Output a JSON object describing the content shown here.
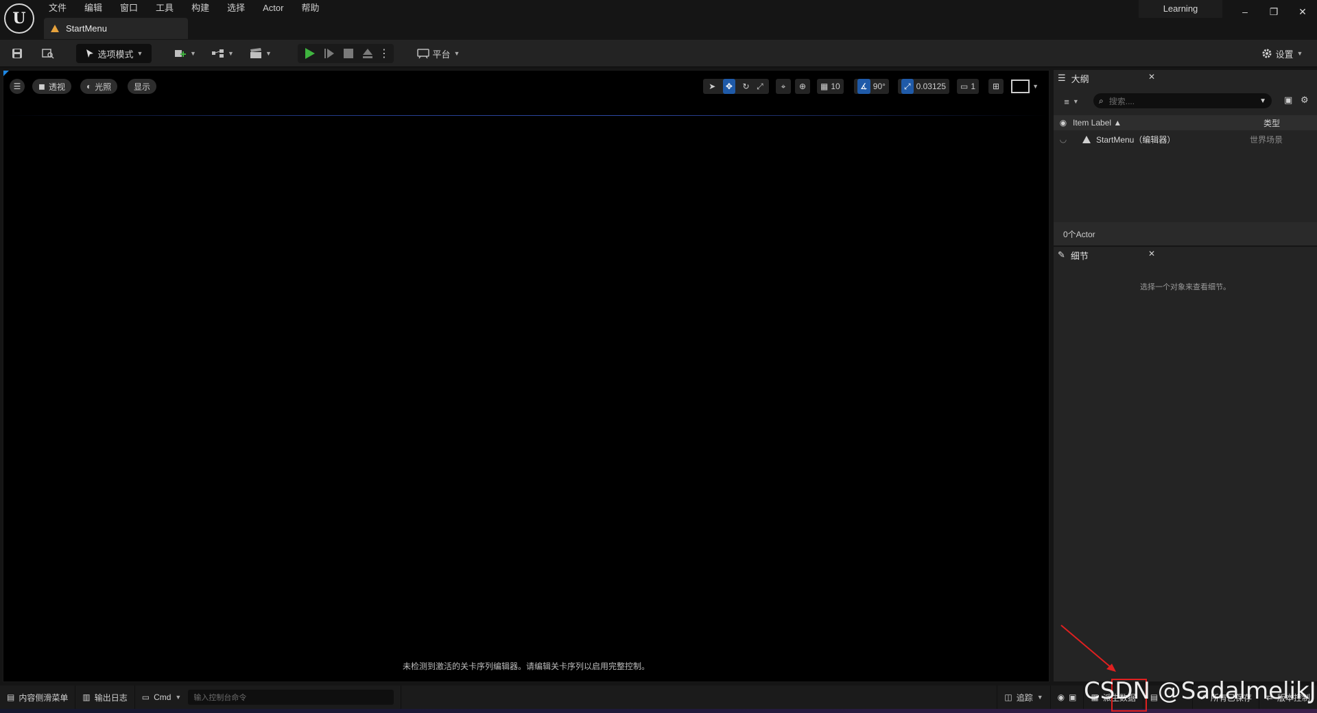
{
  "menu": [
    "文件",
    "编辑",
    "窗口",
    "工具",
    "构建",
    "选择",
    "Actor",
    "帮助"
  ],
  "document_tab": "StartMenu",
  "project_name": "Learning",
  "window_controls": {
    "minimize": "–",
    "restore": "❐",
    "close": "✕"
  },
  "toolbar": {
    "mode_label": "选项模式",
    "platform_label": "平台",
    "settings_label": "设置"
  },
  "viewport": {
    "perspective": "透视",
    "lit": "光照",
    "show": "显示",
    "grid_snap": "10",
    "rotate_snap": "90°",
    "scale_snap": "0.03125",
    "camera_speed": "1",
    "message": "未检测到激活的关卡序列编辑器。请编辑关卡序列以启用完整控制。"
  },
  "outliner": {
    "tab_title": "大纲",
    "search_placeholder": "搜索....",
    "col_label": "Item Label ▲",
    "col_type": "类型",
    "row_label": "StartMenu（编辑器）",
    "row_type": "世界场景",
    "footer": "0个Actor"
  },
  "details": {
    "tab_title": "细节",
    "empty_message": "选择一个对象来查看细节。"
  },
  "statusbar": {
    "content_drawer": "内容侧滑菜单",
    "output_log": "输出日志",
    "cmd": "Cmd",
    "cmd_placeholder": "输入控制台命令",
    "trace": "追踪",
    "derived_data": "派生数据",
    "all_saved": "所有已保存",
    "source_control": "版本控制"
  },
  "watermark": "CSDN @SadalmelikJ",
  "colors": {
    "accent_blue": "#1f5aa8",
    "play_green": "#3fb43f",
    "level_orange": "#e6a23c",
    "annotation_red": "#e02020"
  }
}
